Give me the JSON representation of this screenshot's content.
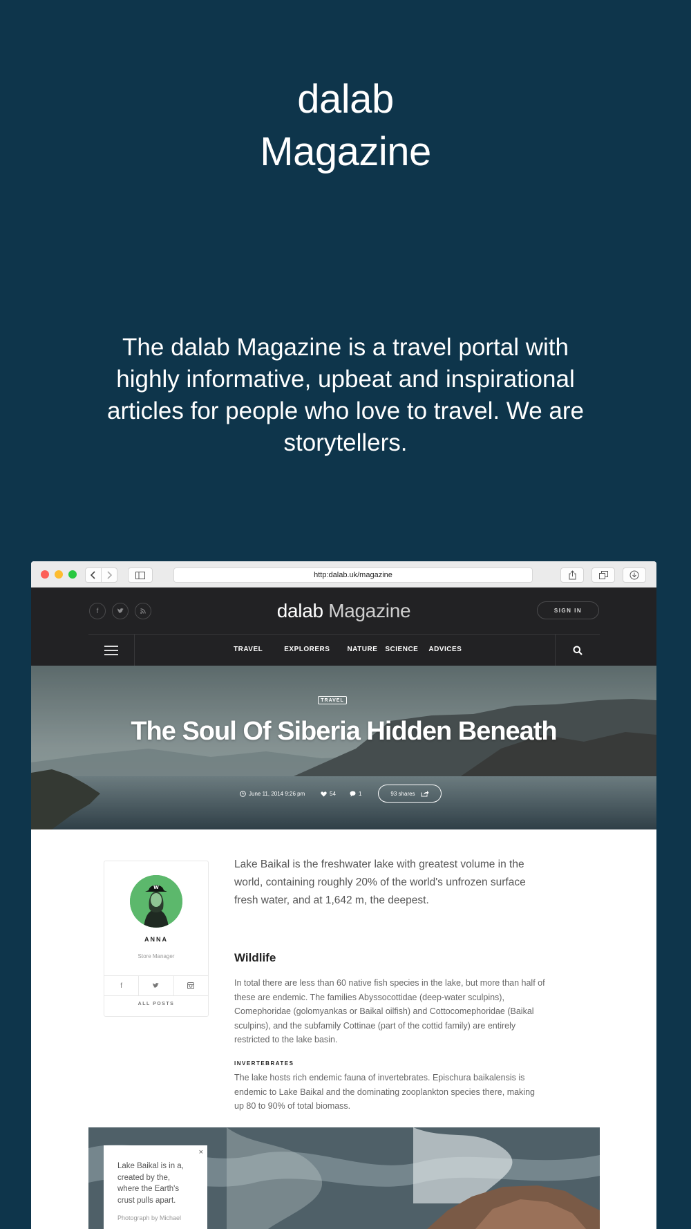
{
  "hero": {
    "title_line1": "dalab",
    "title_line2": "Magazine",
    "tagline": "The dalab Magazine is a travel portal with highly informative, upbeat and inspirational articles for people who love to travel. We are storytellers."
  },
  "browser": {
    "url": "http:dalab.uk/magazine"
  },
  "site": {
    "logo_bold": "dalab",
    "logo_light": "Magazine",
    "sign_in": "SIGN IN",
    "social_icons": [
      "facebook-icon",
      "twitter-icon",
      "rss-icon"
    ],
    "nav": [
      "TRAVEL",
      "EXPLORERS",
      "NATURE",
      "SCIENCE",
      "ADVICES"
    ]
  },
  "article": {
    "category": "TRAVEL",
    "title": "The Soul Of Siberia Hidden Beneath",
    "date": "June 11, 2014 9:26 pm",
    "likes": "54",
    "comments": "1",
    "shares": "93 shares",
    "lead": "Lake Baikal is the freshwater lake with greatest volume in the world, containing roughly 20% of the world's unfrozen surface fresh water, and at 1,642 m, the deepest.",
    "section_title": "Wildlife",
    "section_body": "In total there are less than 60 native fish species in the lake, but more than half of these are endemic. The families Abyssocottidae (deep-water sculpins), Comephoridae (golomyankas or Baikal oilfish) and Cottocomephoridae (Baikal sculpins), and the subfamily Cottinae (part of the cottid family) are entirely restricted to the lake basin.",
    "subsection_title": "INVERTEBRATES",
    "subsection_body": "The lake hosts rich endemic fauna of invertebrates. Epischura baikalensis is endemic to Lake Baikal and the dominating zooplankton species there, making up 80 to 90% of total biomass."
  },
  "author": {
    "name": "ANNA",
    "role": "Store Manager",
    "all_posts": "ALL POSTS"
  },
  "photo_caption": {
    "text": "Lake Baikal is in a, created by the, where the Earth's crust pulls apart.",
    "credit": "Photograph by Michael",
    "close": "×"
  },
  "colors": {
    "background": "#0e354b",
    "header": "#222224"
  }
}
